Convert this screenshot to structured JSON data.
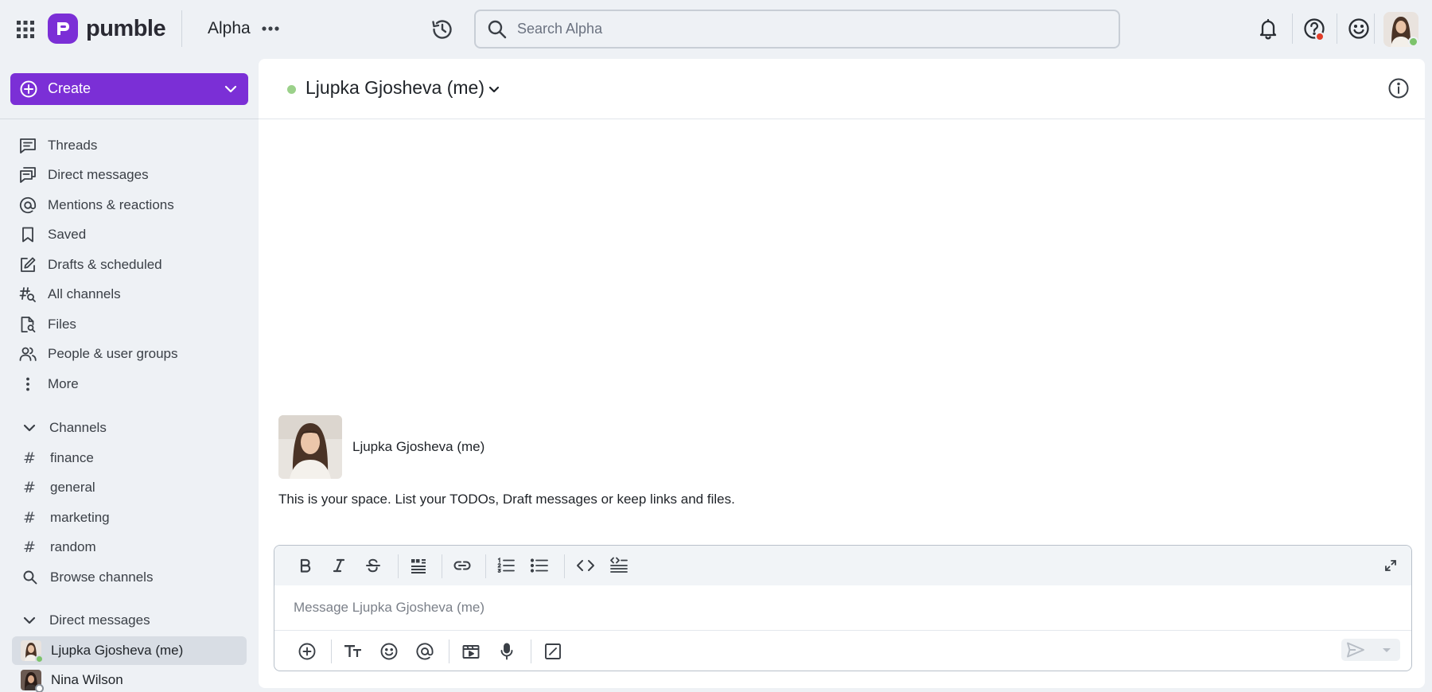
{
  "app": {
    "brand": "pumble",
    "workspace": "Alpha"
  },
  "search": {
    "placeholder": "Search Alpha"
  },
  "sidebar": {
    "create_label": "Create",
    "nav": [
      {
        "label": "Threads",
        "icon": "threads-icon"
      },
      {
        "label": "Direct messages",
        "icon": "direct-messages-icon"
      },
      {
        "label": "Mentions & reactions",
        "icon": "at-sign-icon"
      },
      {
        "label": "Saved",
        "icon": "bookmark-icon"
      },
      {
        "label": "Drafts & scheduled",
        "icon": "draft-pencil-icon"
      },
      {
        "label": "All channels",
        "icon": "channel-search-icon"
      },
      {
        "label": "Files",
        "icon": "file-search-icon"
      },
      {
        "label": "People & user groups",
        "icon": "people-icon"
      },
      {
        "label": "More",
        "icon": "vertical-dots-icon"
      }
    ],
    "channels_heading": "Channels",
    "channels": [
      "finance",
      "general",
      "marketing",
      "random"
    ],
    "browse_channels": "Browse channels",
    "dm_heading": "Direct messages",
    "dms": [
      {
        "name": "Ljupka Gjosheva (me)",
        "status": "online",
        "active": true
      },
      {
        "name": "Nina Wilson",
        "status": "offline",
        "active": false
      }
    ]
  },
  "conversation": {
    "title": "Ljupka Gjosheva (me)",
    "status": "online",
    "intro_name": "Ljupka Gjosheva (me)",
    "intro_text": "This is your space. List your TODOs, Draft messages or keep links and files."
  },
  "composer": {
    "placeholder": "Message Ljupka Gjosheva (me)",
    "format_tools": [
      "bold",
      "italic",
      "strikethrough",
      "blockquote",
      "link",
      "ordered-list",
      "bulleted-list",
      "code",
      "code-block"
    ],
    "actions": [
      "attach",
      "text-format",
      "emoji",
      "mention",
      "gif",
      "voice",
      "slash-command"
    ]
  },
  "colors": {
    "brand": "#7b2fd6",
    "online": "#7cc36b",
    "notification": "#e23d28"
  }
}
